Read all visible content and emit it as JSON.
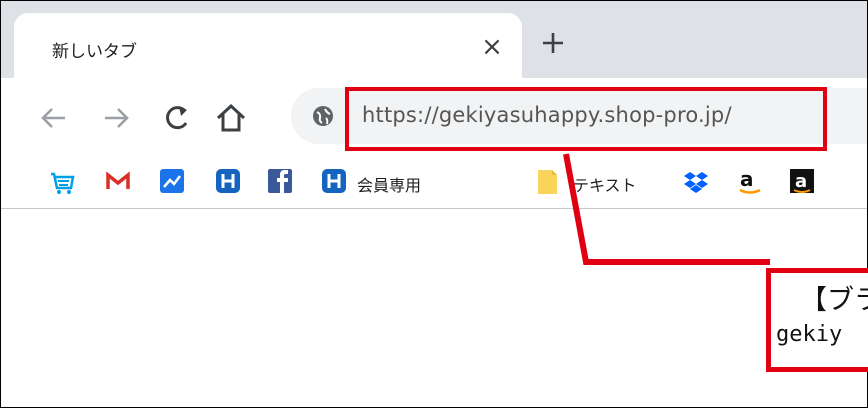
{
  "tab": {
    "title": "新しいタブ",
    "close_icon": "close-icon",
    "new_tab_icon": "plus-icon"
  },
  "toolbar": {
    "back_icon": "back-arrow-icon",
    "forward_icon": "forward-arrow-icon",
    "reload_icon": "reload-icon",
    "home_icon": "home-icon",
    "site_icon": "globe-icon",
    "url": "https://gekiyasuhappy.shop-pro.jp/"
  },
  "bookmarks": [
    {
      "icon": "cart-icon",
      "label": ""
    },
    {
      "icon": "gmail-icon",
      "label": ""
    },
    {
      "icon": "chart-icon",
      "label": ""
    },
    {
      "icon": "h-icon",
      "label": ""
    },
    {
      "icon": "facebook-icon",
      "label": ""
    },
    {
      "icon": "h-icon",
      "label": "会員専用"
    },
    {
      "icon": "folder-icon",
      "label": "テキスト"
    },
    {
      "icon": "dropbox-icon",
      "label": ""
    },
    {
      "icon": "amazon-icon",
      "label": ""
    },
    {
      "icon": "amazon-dark-icon",
      "label": ""
    }
  ],
  "callout": {
    "line1": "【ブラ",
    "line2": "gekiy"
  },
  "colors": {
    "annotation_red": "#e00012",
    "tabstrip": "#dee1e6",
    "omnibox": "#f1f3f4"
  }
}
